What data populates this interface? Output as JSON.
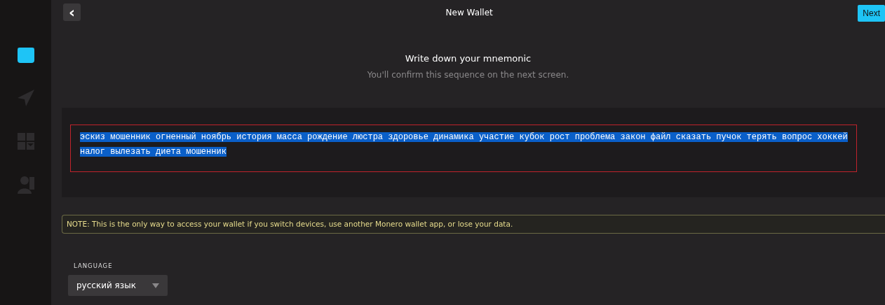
{
  "sidebar": {
    "items": [
      {
        "kind": "wallet",
        "selected": true
      },
      {
        "kind": "send",
        "selected": false
      },
      {
        "kind": "grid",
        "selected": false
      },
      {
        "kind": "person",
        "selected": false
      }
    ]
  },
  "header": {
    "back": "‹",
    "title": "New Wallet",
    "next": "Next"
  },
  "heading": "Write down your mnemonic",
  "subheading": "You'll confirm this sequence on the next screen.",
  "mnemonic": {
    "text": "эскиз мошенник огненный ноябрь история масса рождение люстра здоровье динамика участие кубок рост проблема закон файл сказать пучок терять вопрос хоккей налог вылезать диета мошенник",
    "highlighted": true
  },
  "note": "NOTE: This is the only way to access your wallet if you switch devices, use another Monero wallet app, or lose your data.",
  "language": {
    "label": "LANGUAGE",
    "value": "русский язык"
  }
}
